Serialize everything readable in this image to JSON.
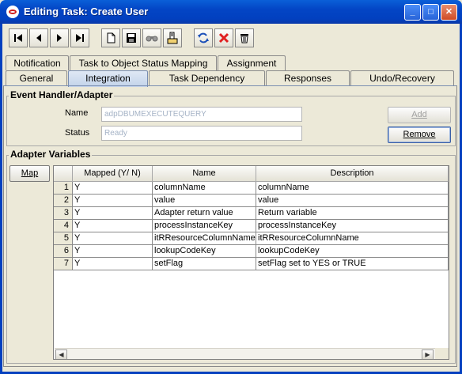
{
  "window": {
    "title": "Editing Task: Create User",
    "min_glyph": "_",
    "max_glyph": "□",
    "close_glyph": "✕"
  },
  "toolbar": {
    "icons": [
      "first-record-icon",
      "previous-record-icon",
      "next-record-icon",
      "last-record-icon",
      "new-icon",
      "save-icon",
      "find-icon",
      "assign-icon",
      "refresh-icon",
      "cancel-icon",
      "delete-icon"
    ]
  },
  "tabs_row1": [
    "Notification",
    "Task to Object Status Mapping",
    "Assignment"
  ],
  "tabs_row2": [
    "General",
    "Integration",
    "Task Dependency",
    "Responses",
    "Undo/Recovery"
  ],
  "active_tab": "Integration",
  "event_handler": {
    "title": "Event Handler/Adapter",
    "name_label": "Name",
    "name_value": "adpDBUMEXECUTEQUERY",
    "status_label": "Status",
    "status_value": "Ready",
    "add_label": "Add",
    "remove_label": "Remove"
  },
  "adapter_vars": {
    "title": "Adapter Variables",
    "map_label": "Map",
    "columns": [
      "",
      "Mapped (Y/ N)",
      "Name",
      "Description"
    ],
    "rows": [
      {
        "num": "1",
        "mapped": "Y",
        "name": "columnName",
        "desc": "columnName"
      },
      {
        "num": "2",
        "mapped": "Y",
        "name": "value",
        "desc": "value"
      },
      {
        "num": "3",
        "mapped": "Y",
        "name": "Adapter return value",
        "desc": "Return variable"
      },
      {
        "num": "4",
        "mapped": "Y",
        "name": "processInstanceKey",
        "desc": "processInstanceKey"
      },
      {
        "num": "5",
        "mapped": "Y",
        "name": "itRResourceColumnName",
        "desc": "itRResourceColumnName"
      },
      {
        "num": "6",
        "mapped": "Y",
        "name": "lookupCodeKey",
        "desc": "lookupCodeKey"
      },
      {
        "num": "7",
        "mapped": "Y",
        "name": "setFlag",
        "desc": "setFlag set to YES or TRUE"
      }
    ],
    "scroll_left": "◀",
    "scroll_right": "▶"
  }
}
